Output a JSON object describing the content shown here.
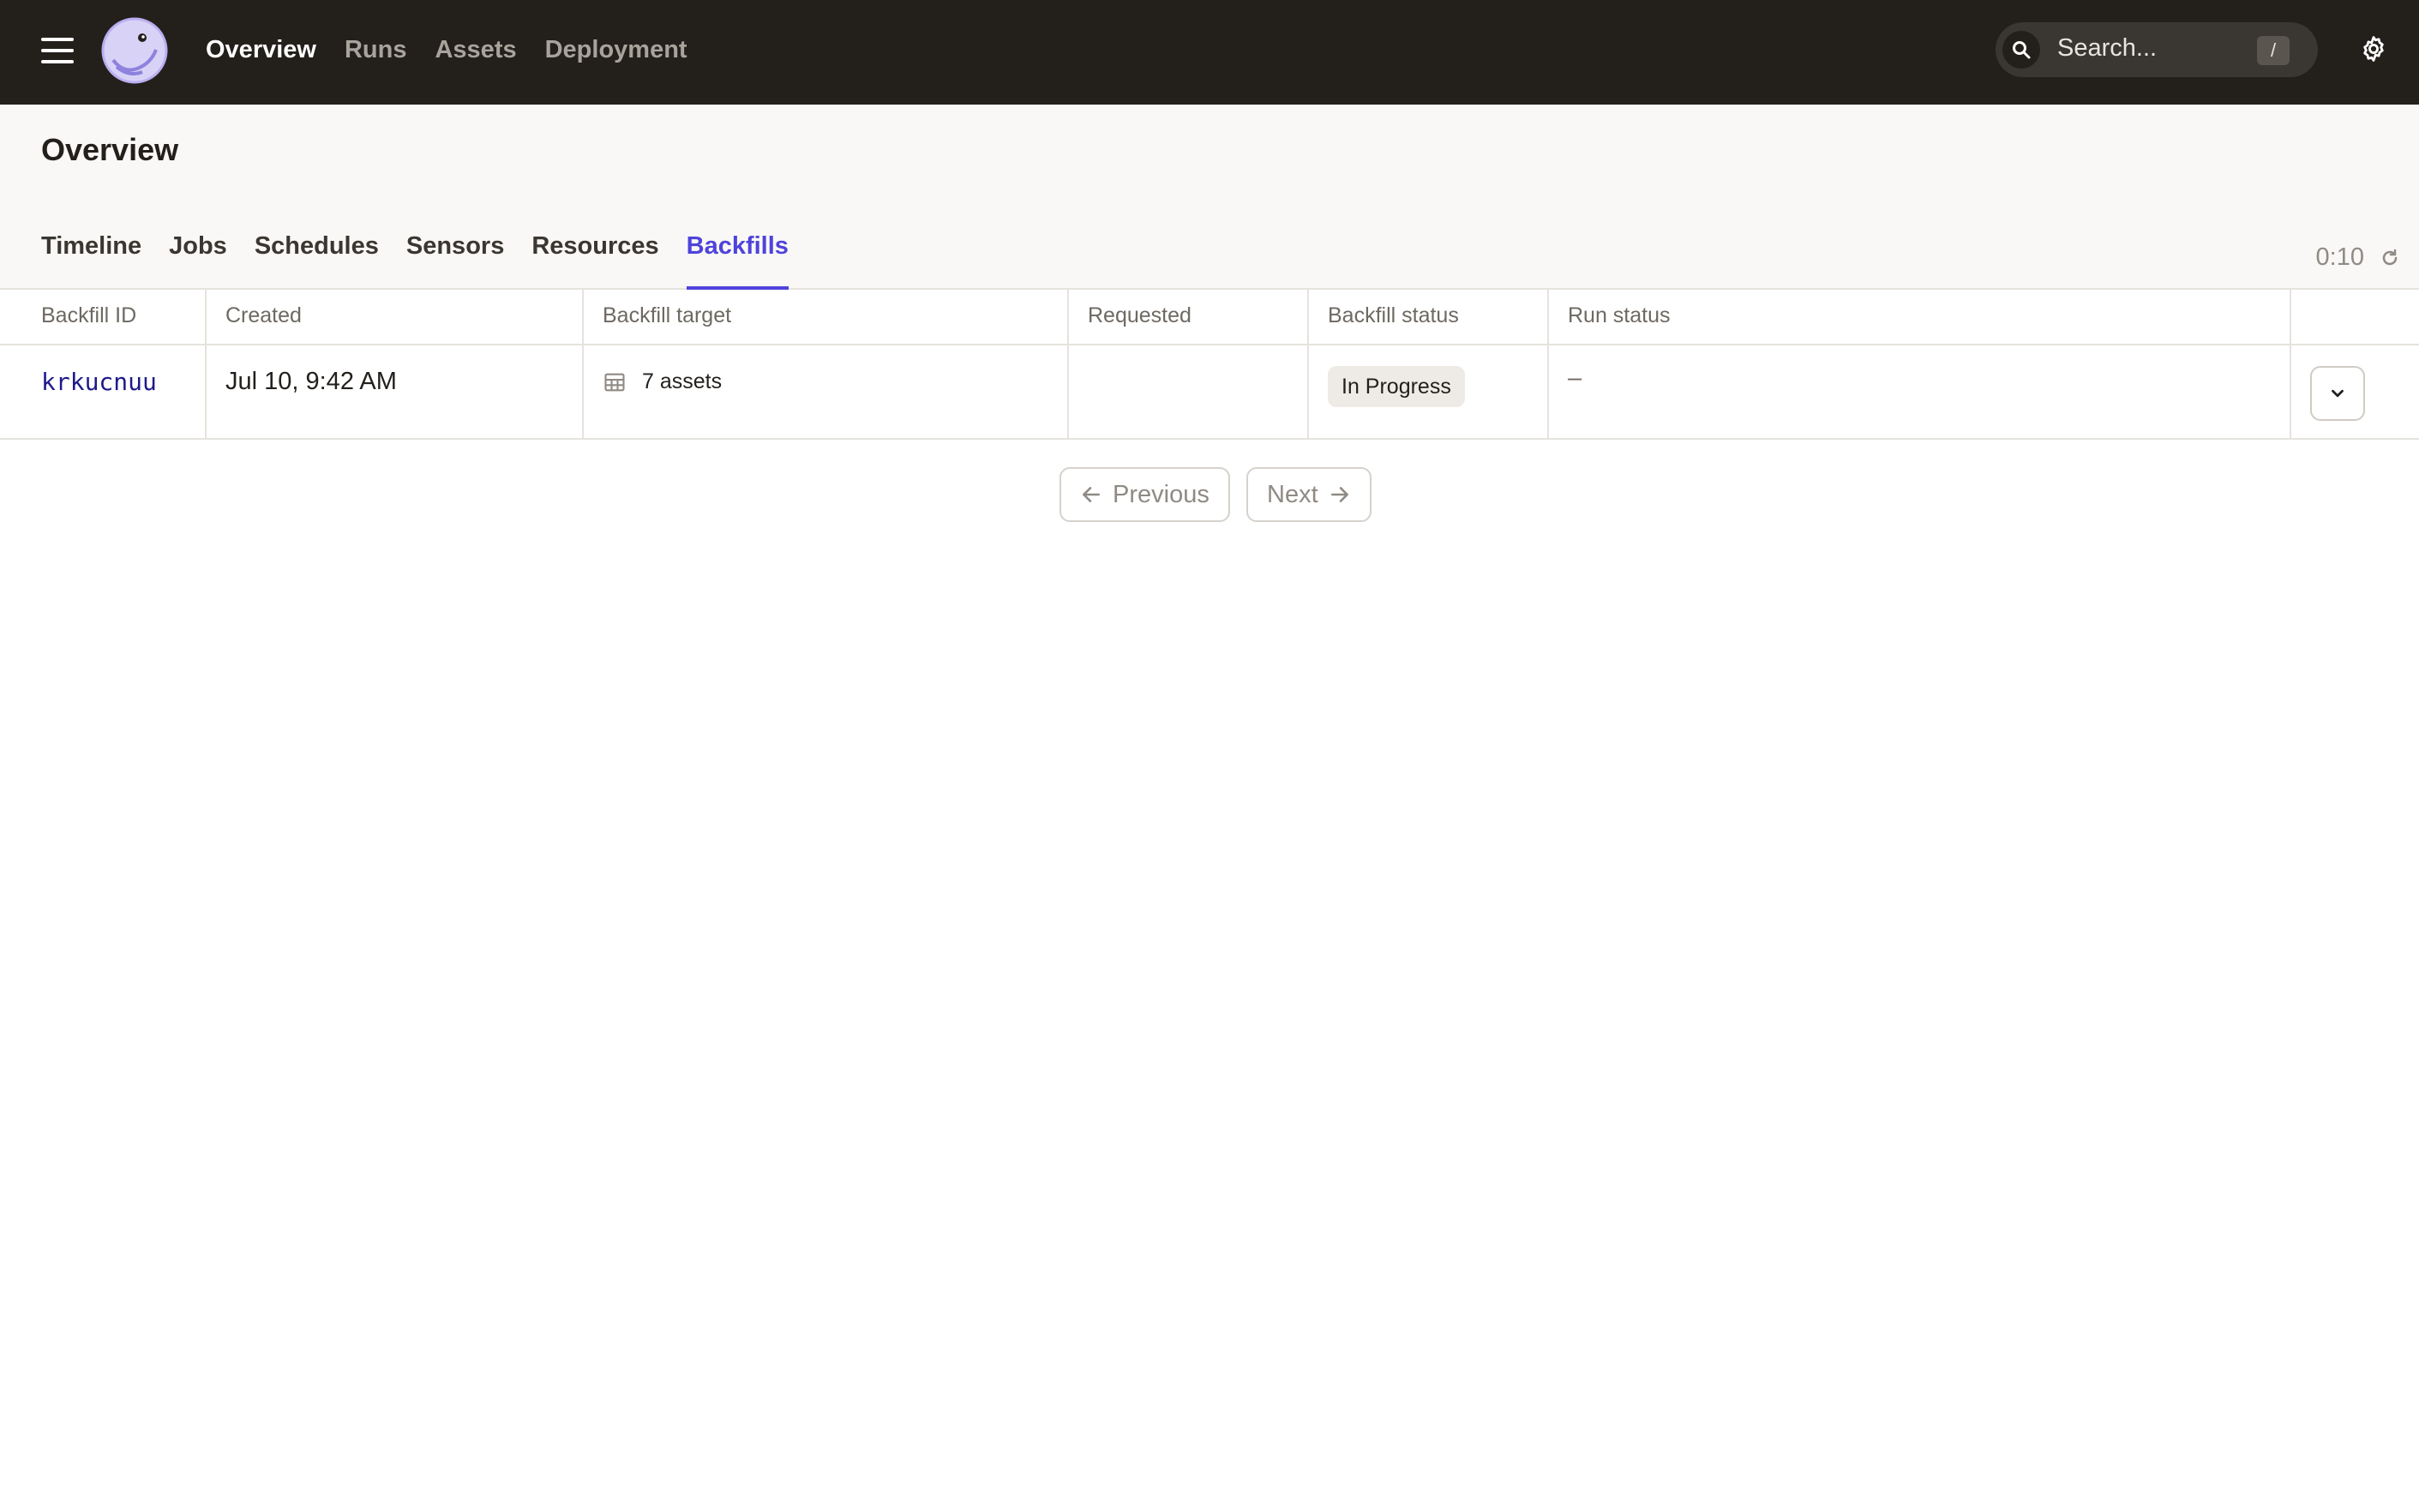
{
  "nav": {
    "items": [
      {
        "label": "Overview",
        "active": true
      },
      {
        "label": "Runs",
        "active": false
      },
      {
        "label": "Assets",
        "active": false
      },
      {
        "label": "Deployment",
        "active": false
      }
    ],
    "search": {
      "placeholder": "Search...",
      "shortcut": "/"
    }
  },
  "page": {
    "title": "Overview",
    "tabs": [
      {
        "label": "Timeline"
      },
      {
        "label": "Jobs"
      },
      {
        "label": "Schedules"
      },
      {
        "label": "Sensors"
      },
      {
        "label": "Resources"
      },
      {
        "label": "Backfills",
        "active": true
      }
    ],
    "refresh_countdown": "0:10"
  },
  "table": {
    "columns": [
      "Backfill ID",
      "Created",
      "Backfill target",
      "Requested",
      "Backfill status",
      "Run status"
    ],
    "rows": [
      {
        "id": "krkucnuu",
        "created": "Jul 10, 9:42 AM",
        "target": "7 assets",
        "requested": "",
        "status": "In Progress",
        "run_status": "–"
      }
    ]
  },
  "pagination": {
    "previous": "Previous",
    "next": "Next"
  },
  "colors": {
    "accent": "#4f43dd",
    "topbar": "#231f1b"
  }
}
